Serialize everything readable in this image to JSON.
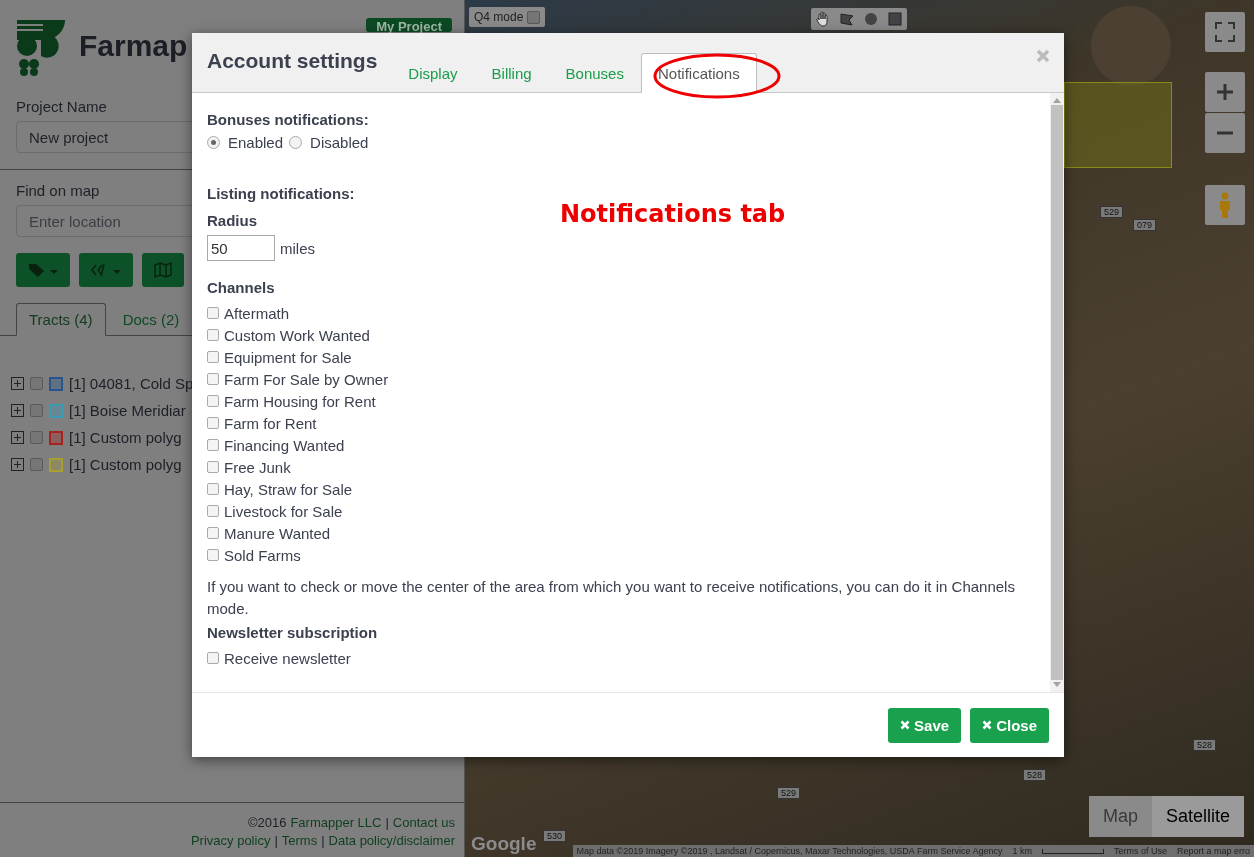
{
  "sidebar": {
    "logo_text": "Farmap",
    "my_project_button": "My Project",
    "project_name": {
      "label": "Project Name",
      "value": "New project"
    },
    "find_on_map": {
      "label": "Find on map",
      "placeholder": "Enter location"
    },
    "tool_buttons": [
      {
        "kind": "tag"
      },
      {
        "kind": "code"
      },
      {
        "kind": "map"
      }
    ],
    "tabs": [
      {
        "label": "Tracts (4)",
        "selected": true
      },
      {
        "label": "Docs  (2)",
        "selected": false
      }
    ],
    "tracts": [
      {
        "label": "[1] 04081, Cold Sp",
        "color": "#2a5590",
        "checked": false
      },
      {
        "label": "[1] Boise Meridiar",
        "color": "#3a9cb4",
        "checked": false
      },
      {
        "label": "[1] Custom polyg",
        "color": "#a82222",
        "checked": false
      },
      {
        "label": "[1] Custom polyg",
        "color": "#a8a030",
        "checked": false
      }
    ],
    "footer": [
      [
        {
          "kind": "text",
          "text": "©2016"
        },
        {
          "kind": "link",
          "text": "Farmapper LLC"
        },
        {
          "kind": "text",
          "text": "|"
        },
        {
          "kind": "link",
          "text": "Contact us"
        }
      ],
      [
        {
          "kind": "link",
          "text": "Privacy policy"
        },
        {
          "kind": "text",
          "text": "|"
        },
        {
          "kind": "link",
          "text": "Terms"
        },
        {
          "kind": "text",
          "text": "|"
        },
        {
          "kind": "link",
          "text": "Data policy/disclaimer"
        }
      ]
    ]
  },
  "map": {
    "q4_mode": {
      "label": "Q4 mode",
      "checked": false
    },
    "road_labels": [
      "529",
      "079",
      "528",
      "528",
      "529",
      "530"
    ],
    "map_types": [
      {
        "label": "Map",
        "selected": false
      },
      {
        "label": "Satellite",
        "selected": true
      }
    ],
    "google_logo": "Google",
    "attribution": "Map data ©2019 Imagery ©2019 , Landsat / Copernicus, Maxar Technologies, USDA Farm Service Agency",
    "scale": "1 km",
    "terms": "Terms of Use",
    "report": "Report a map erro"
  },
  "dialog": {
    "title": "Account settings",
    "tabs": [
      {
        "label": "Display",
        "selected": false
      },
      {
        "label": "Billing",
        "selected": false
      },
      {
        "label": "Bonuses",
        "selected": false
      },
      {
        "label": "Notifications",
        "selected": true
      }
    ],
    "bonuses": {
      "heading": "Bonuses notifications:",
      "options": [
        {
          "label": "Enabled",
          "selected": true
        },
        {
          "label": "Disabled",
          "selected": false
        }
      ]
    },
    "listing": {
      "heading": "Listing notifications:",
      "radius_label": "Radius",
      "radius_value": "50",
      "unit": "miles",
      "channels_heading": "Channels",
      "channels": [
        {
          "label": "Aftermath",
          "checked": false
        },
        {
          "label": "Custom Work Wanted",
          "checked": false
        },
        {
          "label": "Equipment for Sale",
          "checked": false
        },
        {
          "label": "Farm For Sale by Owner",
          "checked": false
        },
        {
          "label": "Farm Housing for Rent",
          "checked": false
        },
        {
          "label": "Farm for Rent",
          "checked": false
        },
        {
          "label": "Financing Wanted",
          "checked": false
        },
        {
          "label": "Free Junk",
          "checked": false
        },
        {
          "label": "Hay, Straw for Sale",
          "checked": false
        },
        {
          "label": "Livestock for Sale",
          "checked": false
        },
        {
          "label": "Manure Wanted",
          "checked": false
        },
        {
          "label": "Sold Farms",
          "checked": false
        }
      ]
    },
    "note": "If you want to check or move the center of the area from which you want to receive notifications, you can do it in Channels mode.",
    "newsletter": {
      "heading": "Newsletter subscription",
      "options": [
        {
          "label": "Receive newsletter",
          "checked": false
        }
      ]
    },
    "buttons": [
      {
        "label": "Save"
      },
      {
        "label": "Close"
      }
    ]
  },
  "annotation": {
    "label": "Notifications tab"
  }
}
